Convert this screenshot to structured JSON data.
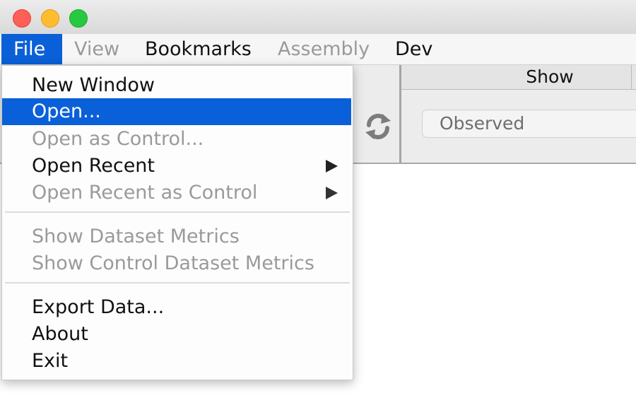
{
  "menubar": {
    "file": "File",
    "view": "View",
    "bookmarks": "Bookmarks",
    "assembly": "Assembly",
    "dev": "Dev"
  },
  "file_menu": {
    "new_window": "New Window",
    "open": "Open...",
    "open_as_control": "Open as Control...",
    "open_recent": "Open Recent",
    "open_recent_as_control": "Open Recent as Control",
    "show_dataset_metrics": "Show Dataset Metrics",
    "show_control_dataset_metrics": "Show Control Dataset Metrics",
    "export_data": "Export Data...",
    "about": "About",
    "exit": "Exit"
  },
  "panel": {
    "show_header": "Show",
    "show_select_value": "Observed"
  },
  "icons": {
    "refresh": "refresh-icon",
    "submenu_arrow": "chevron-right-icon"
  },
  "colors": {
    "highlight": "#0a60d8",
    "disabled_text": "#9a9a9a",
    "close": "#fe5f57",
    "minimize": "#febc2e",
    "maximize": "#28c840"
  }
}
